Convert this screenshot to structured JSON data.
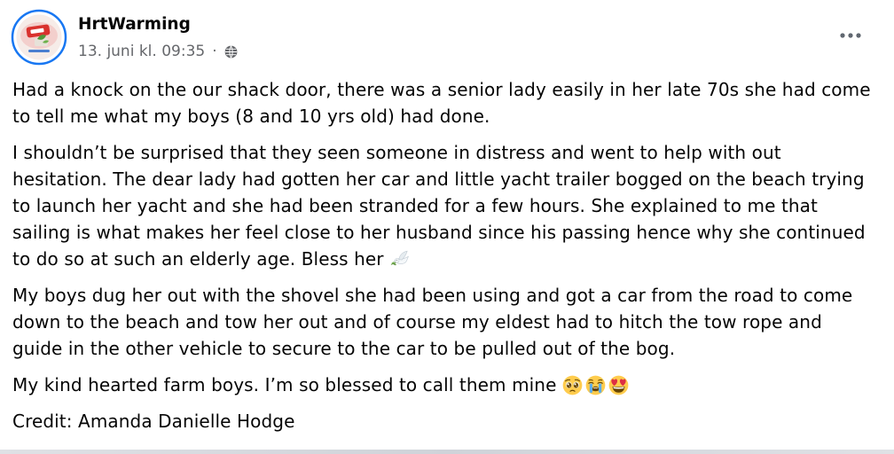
{
  "post": {
    "author": "HrtWarming",
    "timestamp": "13. juni kl. 09:35",
    "separator": "·",
    "privacy_icon": "globe-icon",
    "more_options_icon": "more-options-icon",
    "avatar_icon": "page-avatar-icon",
    "paragraphs": [
      {
        "lines": [
          "Had a knock on the our shack door, there was a senior lady easily in her late 70s she had come",
          "to tell me what my boys (8 and 10 yrs old) had done."
        ]
      },
      {
        "lines": [
          "I shouldn’t be surprised that they seen someone in distress and went to help with out",
          "hesitation. The dear lady had gotten her car and little yacht trailer bogged on the beach trying",
          "to launch her yacht and she had been stranded for a few hours. She explained to me that",
          "sailing is what makes her feel close to her husband since his passing hence why she continued",
          "to do so at such an elderly age. Bless her"
        ],
        "emoji": [
          "dove-icon"
        ]
      },
      {
        "lines": [
          "My boys dug her out with the shovel she had been using and got a car from the road to come",
          "down to the beach and tow her out and of course my eldest had to hitch the tow rope and",
          "guide in the other vehicle to secure to the car to be pulled out of the bog."
        ]
      },
      {
        "lines": [
          "My kind hearted farm boys. I’m so blessed to call them mine"
        ],
        "emoji": [
          "pleading-face-icon",
          "loudly-crying-face-icon",
          "smiling-face-with-heart-eyes-icon"
        ]
      },
      {
        "lines": [
          "Credit: Amanda Danielle Hodge"
        ]
      }
    ]
  },
  "colors": {
    "text_primary": "#050505",
    "text_secondary": "#65676B",
    "avatar_ring": "#1877F2",
    "background": "#FFFFFF"
  }
}
